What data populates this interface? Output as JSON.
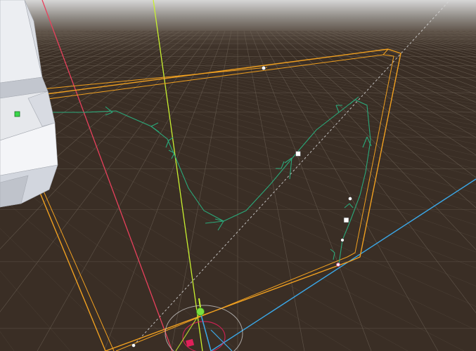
{
  "scene_view": {
    "tool": "spline-edit",
    "colors": {
      "sky_top": "#d4d4d4",
      "sky_bottom": "#6b655e",
      "ground": "#3a2e25",
      "grid_line": "#6e6357",
      "bounds_box": "#f0a020",
      "spline": "#2aa97a",
      "axis_x": "#e8405c",
      "axis_y": "#c8f030",
      "axis_z": "#3aa8e8",
      "guide_line": "#d8d8d8",
      "object_face_light": "#eef0f4",
      "object_face_mid": "#d8dce4",
      "object_face_dark": "#b8bcc6",
      "pivot_marker": "#39d84a",
      "transform_gizmo_ring": "#d8d8d8",
      "transform_gizmo_handle": "#e0205a"
    },
    "icons": {
      "pivot": "green-square-pivot-icon",
      "control_point": "white-square-handle-icon",
      "tangent_point": "white-dot-handle-icon",
      "gizmo_center": "green-sphere-icon",
      "gizmo_axis_handle": "pink-square-icon"
    }
  }
}
